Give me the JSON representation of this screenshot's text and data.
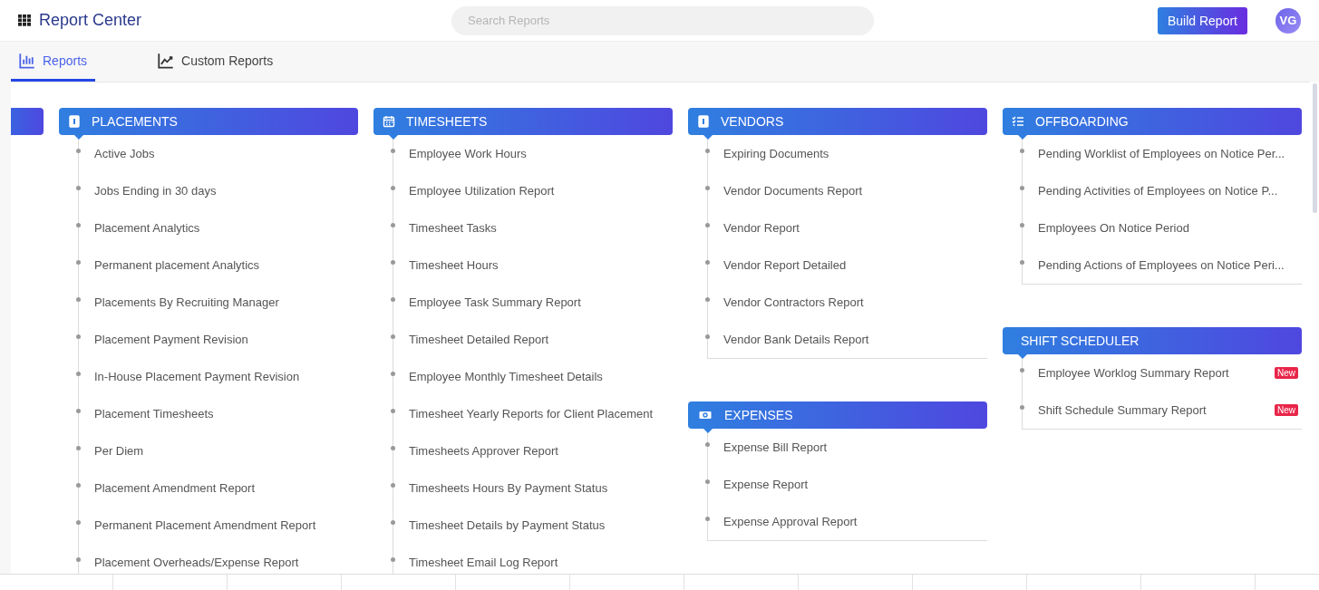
{
  "header": {
    "title": "Report Center",
    "search": {
      "placeholder": "Search Reports"
    },
    "build_button": "Build Report",
    "avatar": "VG"
  },
  "tabs": [
    {
      "label": "Reports",
      "kind": "bars",
      "selected": true
    },
    {
      "label": "Custom Reports",
      "kind": "trend",
      "selected": false
    }
  ],
  "columns": [
    {
      "sections": [
        {
          "title": "PLACEMENTS",
          "kind": "badge",
          "items": [
            {
              "label": "Active Jobs"
            },
            {
              "label": "Jobs Ending in 30 days"
            },
            {
              "label": "Placement Analytics"
            },
            {
              "label": "Permanent placement Analytics"
            },
            {
              "label": "Placements By Recruiting Manager"
            },
            {
              "label": "Placement Payment Revision"
            },
            {
              "label": "In-House Placement Payment Revision"
            },
            {
              "label": "Placement Timesheets"
            },
            {
              "label": "Per Diem"
            },
            {
              "label": "Placement Amendment Report"
            },
            {
              "label": "Permanent Placement Amendment Report"
            },
            {
              "label": "Placement Overheads/Expense Report"
            }
          ]
        }
      ]
    },
    {
      "sections": [
        {
          "title": "TIMESHEETS",
          "kind": "calendar",
          "items": [
            {
              "label": "Employee Work Hours"
            },
            {
              "label": "Employee Utilization Report"
            },
            {
              "label": "Timesheet Tasks"
            },
            {
              "label": "Timesheet Hours"
            },
            {
              "label": "Employee Task Summary Report"
            },
            {
              "label": "Timesheet Detailed Report"
            },
            {
              "label": "Employee Monthly Timesheet Details"
            },
            {
              "label": "Timesheet Yearly Reports for Client Placement"
            },
            {
              "label": "Timesheets Approver Report"
            },
            {
              "label": "Timesheets Hours By Payment Status"
            },
            {
              "label": "Timesheet Details by Payment Status"
            },
            {
              "label": "Timesheet Email Log Report"
            }
          ]
        }
      ]
    },
    {
      "sections": [
        {
          "title": "VENDORS",
          "kind": "badge",
          "items": [
            {
              "label": "Expiring Documents"
            },
            {
              "label": "Vendor Documents Report"
            },
            {
              "label": "Vendor Report"
            },
            {
              "label": "Vendor Report Detailed"
            },
            {
              "label": "Vendor Contractors Report"
            },
            {
              "label": "Vendor Bank Details Report"
            }
          ]
        },
        {
          "title": "EXPENSES",
          "kind": "money",
          "items": [
            {
              "label": "Expense Bill Report"
            },
            {
              "label": "Expense Report"
            },
            {
              "label": "Expense Approval Report"
            }
          ]
        }
      ]
    },
    {
      "sections": [
        {
          "title": "OFFBOARDING",
          "kind": "list",
          "items": [
            {
              "label": "Pending Worklist of Employees on Notice Per..."
            },
            {
              "label": "Pending Activities of Employees on Notice P..."
            },
            {
              "label": "Employees On Notice Period"
            },
            {
              "label": "Pending Actions of Employees on Notice Peri..."
            }
          ]
        },
        {
          "title": "SHIFT SCHEDULER",
          "kind": "plain",
          "items": [
            {
              "label": "Employee Worklog Summary Report",
              "badge": "New"
            },
            {
              "label": "Shift Schedule Summary Report",
              "badge": "New"
            }
          ]
        }
      ]
    }
  ]
}
